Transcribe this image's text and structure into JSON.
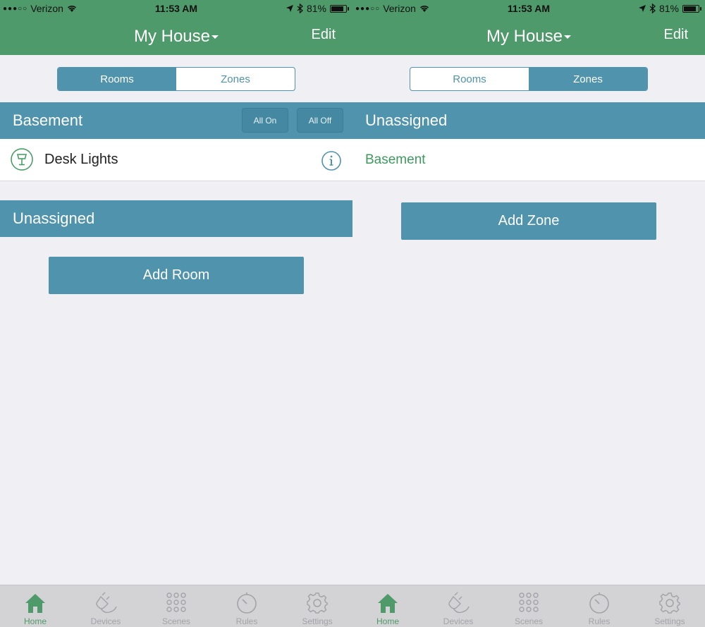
{
  "status": {
    "carrier": "Verizon",
    "time": "11:53 AM",
    "battery": "81%",
    "battery_level": 0.81
  },
  "header": {
    "title": "My House",
    "edit_label": "Edit"
  },
  "segments": {
    "rooms": "Rooms",
    "zones": "Zones"
  },
  "rooms_screen": {
    "section_basement": "Basement",
    "all_on": "All On",
    "all_off": "All Off",
    "device_name": "Desk Lights",
    "section_unassigned": "Unassigned",
    "add_room": "Add Room"
  },
  "zones_screen": {
    "section_unassigned": "Unassigned",
    "zone_item": "Basement",
    "add_zone": "Add Zone"
  },
  "tabs": [
    {
      "label": "Home",
      "icon": "home-icon",
      "active": true
    },
    {
      "label": "Devices",
      "icon": "plug-icon",
      "active": false
    },
    {
      "label": "Scenes",
      "icon": "grid-dots-icon",
      "active": false
    },
    {
      "label": "Rules",
      "icon": "timer-icon",
      "active": false
    },
    {
      "label": "Settings",
      "icon": "gear-icon",
      "active": false
    }
  ],
  "colors": {
    "header_green": "#4f9a6a",
    "accent_blue": "#4f93ac",
    "background": "#efeff4",
    "zone_text_green": "#3d9a5f"
  }
}
